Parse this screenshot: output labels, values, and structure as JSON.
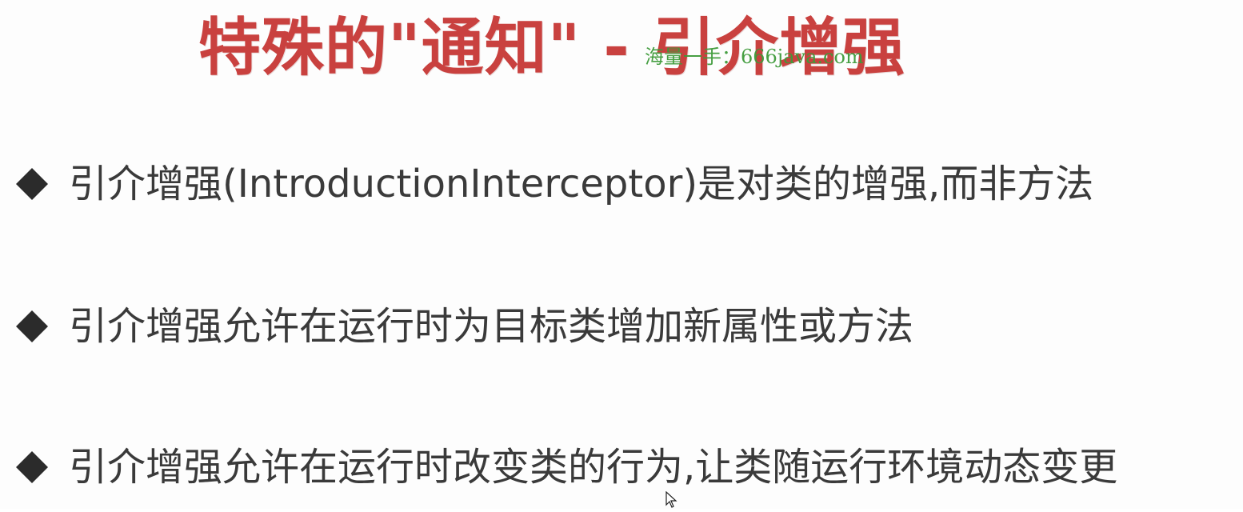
{
  "slide": {
    "title": "特殊的\"通知\" - 引介增强",
    "watermark": "海量一手：666java.com",
    "bullets": [
      {
        "icon": "diamond-bullet-icon",
        "text": "引介增强(IntroductionInterceptor)是对类的增强,而非方法"
      },
      {
        "icon": "diamond-bullet-icon",
        "text": "引介增强允许在运行时为目标类增加新属性或方法"
      },
      {
        "icon": "diamond-bullet-icon",
        "text": "引介增强允许在运行时改变类的行为,让类随运行环境动态变更"
      }
    ]
  },
  "colors": {
    "title": "#c9413f",
    "watermark": "#3e9a3a",
    "body_text": "#3a3a3a",
    "bullet": "#2b2b2b"
  }
}
